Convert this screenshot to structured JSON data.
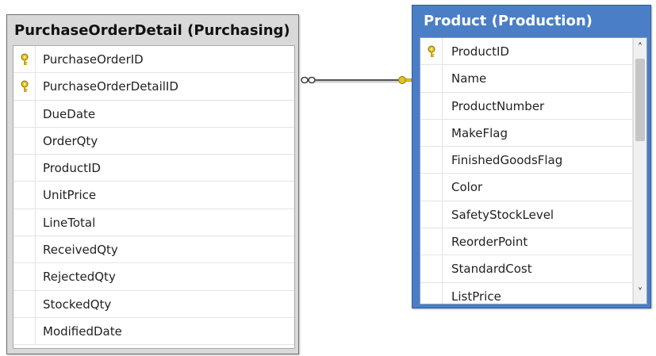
{
  "left_table": {
    "title": "PurchaseOrderDetail (Purchasing)",
    "columns": [
      {
        "name": "PurchaseOrderID",
        "key": true
      },
      {
        "name": "PurchaseOrderDetailID",
        "key": true
      },
      {
        "name": "DueDate",
        "key": false
      },
      {
        "name": "OrderQty",
        "key": false
      },
      {
        "name": "ProductID",
        "key": false
      },
      {
        "name": "UnitPrice",
        "key": false
      },
      {
        "name": "LineTotal",
        "key": false
      },
      {
        "name": "ReceivedQty",
        "key": false
      },
      {
        "name": "RejectedQty",
        "key": false
      },
      {
        "name": "StockedQty",
        "key": false
      },
      {
        "name": "ModifiedDate",
        "key": false
      }
    ]
  },
  "right_table": {
    "title": "Product (Production)",
    "columns": [
      {
        "name": "ProductID",
        "key": true
      },
      {
        "name": "Name",
        "key": false
      },
      {
        "name": "ProductNumber",
        "key": false
      },
      {
        "name": "MakeFlag",
        "key": false
      },
      {
        "name": "FinishedGoodsFlag",
        "key": false
      },
      {
        "name": "Color",
        "key": false
      },
      {
        "name": "SafetyStockLevel",
        "key": false
      },
      {
        "name": "ReorderPoint",
        "key": false
      },
      {
        "name": "StandardCost",
        "key": false
      },
      {
        "name": "ListPrice",
        "key": false
      }
    ]
  },
  "icons": {
    "key": "key-icon",
    "scroll_up": "chevron-up-icon",
    "scroll_down": "chevron-down-icon",
    "relationship_many_end": "infinity-icon",
    "relationship_one_end": "key-icon",
    "annotation": "red-arrow-icon"
  },
  "colors": {
    "left_header": "#d9d9d9",
    "right_header": "#4a7ec6",
    "annotation_arrow": "#c0272d",
    "key_icon": "#e5c21e"
  }
}
